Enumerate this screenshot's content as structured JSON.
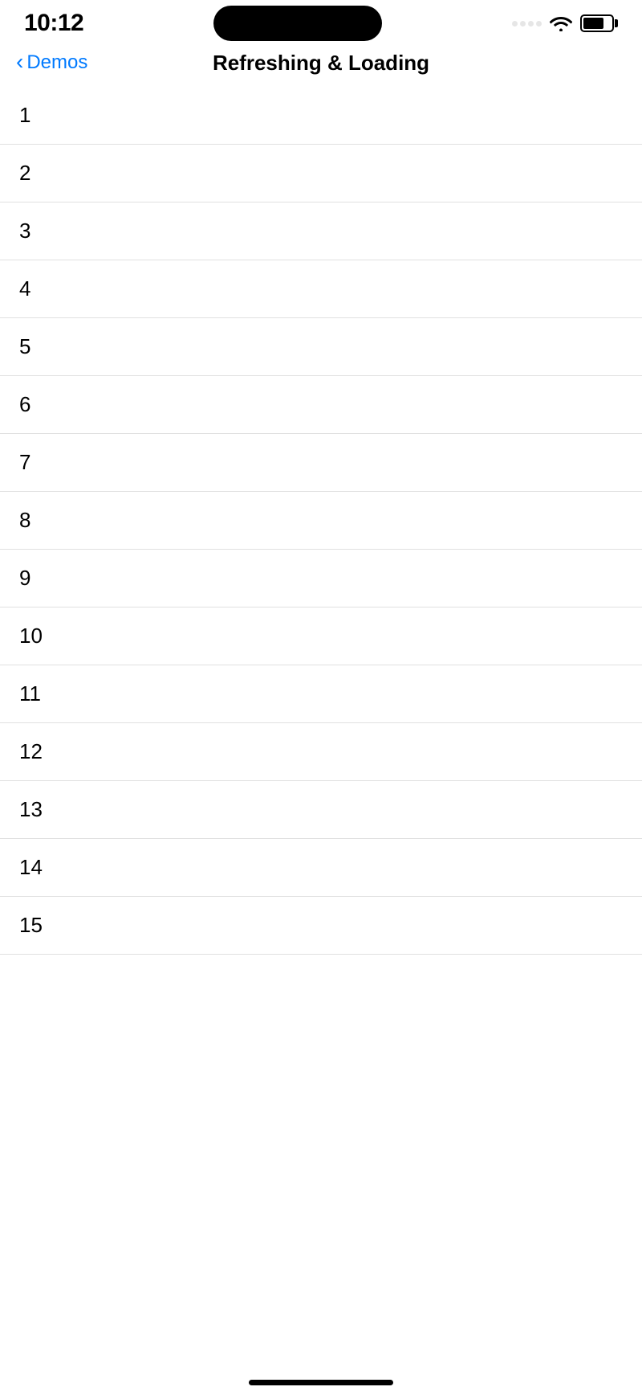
{
  "statusBar": {
    "time": "10:12"
  },
  "navBar": {
    "backLabel": "Demos",
    "title": "Refreshing & Loading"
  },
  "list": {
    "items": [
      {
        "number": "1"
      },
      {
        "number": "2"
      },
      {
        "number": "3"
      },
      {
        "number": "4"
      },
      {
        "number": "5"
      },
      {
        "number": "6"
      },
      {
        "number": "7"
      },
      {
        "number": "8"
      },
      {
        "number": "9"
      },
      {
        "number": "10"
      },
      {
        "number": "11"
      },
      {
        "number": "12"
      },
      {
        "number": "13"
      },
      {
        "number": "14"
      },
      {
        "number": "15"
      }
    ]
  }
}
